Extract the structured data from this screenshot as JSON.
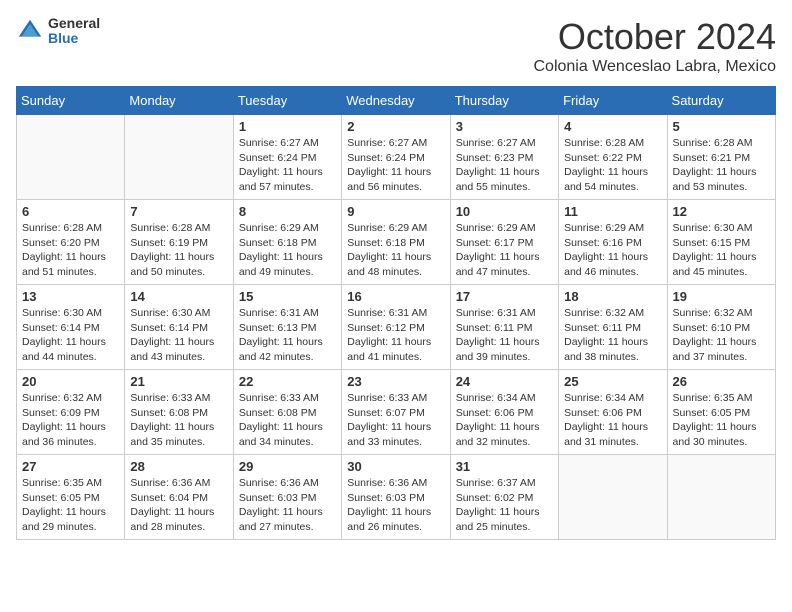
{
  "logo": {
    "general": "General",
    "blue": "Blue"
  },
  "title": "October 2024",
  "subtitle": "Colonia Wenceslao Labra, Mexico",
  "days_of_week": [
    "Sunday",
    "Monday",
    "Tuesday",
    "Wednesday",
    "Thursday",
    "Friday",
    "Saturday"
  ],
  "weeks": [
    [
      {
        "day": "",
        "sunrise": "",
        "sunset": "",
        "daylight": ""
      },
      {
        "day": "",
        "sunrise": "",
        "sunset": "",
        "daylight": ""
      },
      {
        "day": "1",
        "sunrise": "Sunrise: 6:27 AM",
        "sunset": "Sunset: 6:24 PM",
        "daylight": "Daylight: 11 hours and 57 minutes."
      },
      {
        "day": "2",
        "sunrise": "Sunrise: 6:27 AM",
        "sunset": "Sunset: 6:24 PM",
        "daylight": "Daylight: 11 hours and 56 minutes."
      },
      {
        "day": "3",
        "sunrise": "Sunrise: 6:27 AM",
        "sunset": "Sunset: 6:23 PM",
        "daylight": "Daylight: 11 hours and 55 minutes."
      },
      {
        "day": "4",
        "sunrise": "Sunrise: 6:28 AM",
        "sunset": "Sunset: 6:22 PM",
        "daylight": "Daylight: 11 hours and 54 minutes."
      },
      {
        "day": "5",
        "sunrise": "Sunrise: 6:28 AM",
        "sunset": "Sunset: 6:21 PM",
        "daylight": "Daylight: 11 hours and 53 minutes."
      }
    ],
    [
      {
        "day": "6",
        "sunrise": "Sunrise: 6:28 AM",
        "sunset": "Sunset: 6:20 PM",
        "daylight": "Daylight: 11 hours and 51 minutes."
      },
      {
        "day": "7",
        "sunrise": "Sunrise: 6:28 AM",
        "sunset": "Sunset: 6:19 PM",
        "daylight": "Daylight: 11 hours and 50 minutes."
      },
      {
        "day": "8",
        "sunrise": "Sunrise: 6:29 AM",
        "sunset": "Sunset: 6:18 PM",
        "daylight": "Daylight: 11 hours and 49 minutes."
      },
      {
        "day": "9",
        "sunrise": "Sunrise: 6:29 AM",
        "sunset": "Sunset: 6:18 PM",
        "daylight": "Daylight: 11 hours and 48 minutes."
      },
      {
        "day": "10",
        "sunrise": "Sunrise: 6:29 AM",
        "sunset": "Sunset: 6:17 PM",
        "daylight": "Daylight: 11 hours and 47 minutes."
      },
      {
        "day": "11",
        "sunrise": "Sunrise: 6:29 AM",
        "sunset": "Sunset: 6:16 PM",
        "daylight": "Daylight: 11 hours and 46 minutes."
      },
      {
        "day": "12",
        "sunrise": "Sunrise: 6:30 AM",
        "sunset": "Sunset: 6:15 PM",
        "daylight": "Daylight: 11 hours and 45 minutes."
      }
    ],
    [
      {
        "day": "13",
        "sunrise": "Sunrise: 6:30 AM",
        "sunset": "Sunset: 6:14 PM",
        "daylight": "Daylight: 11 hours and 44 minutes."
      },
      {
        "day": "14",
        "sunrise": "Sunrise: 6:30 AM",
        "sunset": "Sunset: 6:14 PM",
        "daylight": "Daylight: 11 hours and 43 minutes."
      },
      {
        "day": "15",
        "sunrise": "Sunrise: 6:31 AM",
        "sunset": "Sunset: 6:13 PM",
        "daylight": "Daylight: 11 hours and 42 minutes."
      },
      {
        "day": "16",
        "sunrise": "Sunrise: 6:31 AM",
        "sunset": "Sunset: 6:12 PM",
        "daylight": "Daylight: 11 hours and 41 minutes."
      },
      {
        "day": "17",
        "sunrise": "Sunrise: 6:31 AM",
        "sunset": "Sunset: 6:11 PM",
        "daylight": "Daylight: 11 hours and 39 minutes."
      },
      {
        "day": "18",
        "sunrise": "Sunrise: 6:32 AM",
        "sunset": "Sunset: 6:11 PM",
        "daylight": "Daylight: 11 hours and 38 minutes."
      },
      {
        "day": "19",
        "sunrise": "Sunrise: 6:32 AM",
        "sunset": "Sunset: 6:10 PM",
        "daylight": "Daylight: 11 hours and 37 minutes."
      }
    ],
    [
      {
        "day": "20",
        "sunrise": "Sunrise: 6:32 AM",
        "sunset": "Sunset: 6:09 PM",
        "daylight": "Daylight: 11 hours and 36 minutes."
      },
      {
        "day": "21",
        "sunrise": "Sunrise: 6:33 AM",
        "sunset": "Sunset: 6:08 PM",
        "daylight": "Daylight: 11 hours and 35 minutes."
      },
      {
        "day": "22",
        "sunrise": "Sunrise: 6:33 AM",
        "sunset": "Sunset: 6:08 PM",
        "daylight": "Daylight: 11 hours and 34 minutes."
      },
      {
        "day": "23",
        "sunrise": "Sunrise: 6:33 AM",
        "sunset": "Sunset: 6:07 PM",
        "daylight": "Daylight: 11 hours and 33 minutes."
      },
      {
        "day": "24",
        "sunrise": "Sunrise: 6:34 AM",
        "sunset": "Sunset: 6:06 PM",
        "daylight": "Daylight: 11 hours and 32 minutes."
      },
      {
        "day": "25",
        "sunrise": "Sunrise: 6:34 AM",
        "sunset": "Sunset: 6:06 PM",
        "daylight": "Daylight: 11 hours and 31 minutes."
      },
      {
        "day": "26",
        "sunrise": "Sunrise: 6:35 AM",
        "sunset": "Sunset: 6:05 PM",
        "daylight": "Daylight: 11 hours and 30 minutes."
      }
    ],
    [
      {
        "day": "27",
        "sunrise": "Sunrise: 6:35 AM",
        "sunset": "Sunset: 6:05 PM",
        "daylight": "Daylight: 11 hours and 29 minutes."
      },
      {
        "day": "28",
        "sunrise": "Sunrise: 6:36 AM",
        "sunset": "Sunset: 6:04 PM",
        "daylight": "Daylight: 11 hours and 28 minutes."
      },
      {
        "day": "29",
        "sunrise": "Sunrise: 6:36 AM",
        "sunset": "Sunset: 6:03 PM",
        "daylight": "Daylight: 11 hours and 27 minutes."
      },
      {
        "day": "30",
        "sunrise": "Sunrise: 6:36 AM",
        "sunset": "Sunset: 6:03 PM",
        "daylight": "Daylight: 11 hours and 26 minutes."
      },
      {
        "day": "31",
        "sunrise": "Sunrise: 6:37 AM",
        "sunset": "Sunset: 6:02 PM",
        "daylight": "Daylight: 11 hours and 25 minutes."
      },
      {
        "day": "",
        "sunrise": "",
        "sunset": "",
        "daylight": ""
      },
      {
        "day": "",
        "sunrise": "",
        "sunset": "",
        "daylight": ""
      }
    ]
  ]
}
